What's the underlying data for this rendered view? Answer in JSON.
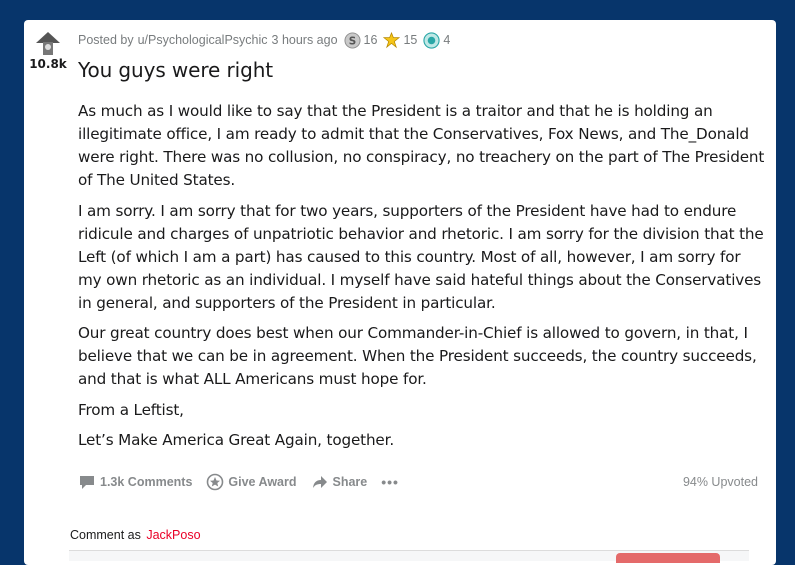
{
  "post": {
    "score": "10.8k",
    "posted_by": "Posted by",
    "author": "u/PsychologicalPsychic",
    "time": "3 hours ago",
    "awards": [
      {
        "icon": "silver-award-icon",
        "count": "16",
        "color": "#8c8c8c"
      },
      {
        "icon": "gold-award-icon",
        "count": "15",
        "color": "#e6b800"
      },
      {
        "icon": "platinum-award-icon",
        "count": "4",
        "color": "#2aa7a7"
      }
    ],
    "title": "You guys were right",
    "paragraphs": [
      "As much as I would like to say that the President is a traitor and that he is holding an illegitimate office, I am ready to admit that the Conservatives, Fox News, and The_Donald were right. There was no collusion, no conspiracy, no treachery on the part of The President of The United States.",
      "I am sorry. I am sorry that for two years, supporters of the President have had to endure ridicule and charges of unpatriotic behavior and rhetoric. I am sorry for the division that the Left (of which I am a part) has caused to this country. Most of all, however, I am sorry for my own rhetoric as an individual. I myself have said hateful things about the Conservatives in general, and supporters of the President in particular.",
      "Our great country does best when our Commander-in-Chief is allowed to govern, in that, I believe that we can be in agreement. When the President succeeds, the country succeeds, and that is what ALL Americans must hope for.",
      "From a Leftist,",
      "Let’s Make America Great Again, together."
    ]
  },
  "actions": {
    "comments": "1.3k Comments",
    "give_award": "Give Award",
    "share": "Share",
    "more": "•••",
    "upvoted": "94% Upvoted"
  },
  "comment": {
    "label": "Comment as",
    "user": "JackPoso"
  },
  "colors": {
    "background": "#07356b",
    "card": "#ffffff",
    "username_accent": "#ea0027"
  }
}
